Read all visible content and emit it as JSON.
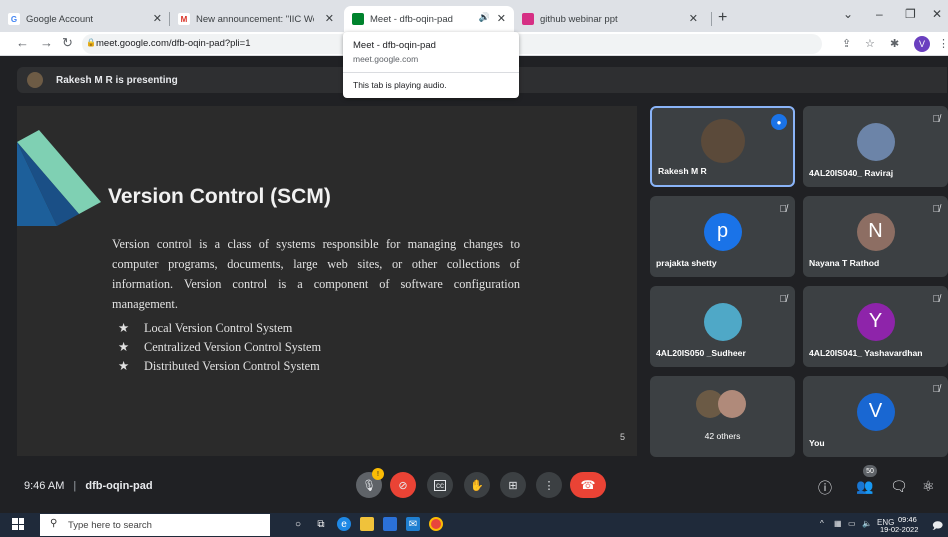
{
  "browser": {
    "tabs": [
      {
        "title": "Google Account",
        "close": "✕"
      },
      {
        "title": "New announcement: \"IIC Webina",
        "close": "✕"
      },
      {
        "title": "Meet - dfb-oqin-pad",
        "close": "✕",
        "audio": "🔊"
      },
      {
        "title": "github webinar ppt",
        "close": "✕"
      }
    ],
    "new_tab": "+",
    "window_controls": {
      "dropdown": "⌄",
      "minimize": "–",
      "restore": "❐",
      "close": "✕"
    },
    "url": "meet.google.com/dfb-oqin-pad?pli=1",
    "profile_initial": "V",
    "hover_card": {
      "title": "Meet - dfb-oqin-pad",
      "domain": "meet.google.com",
      "status": "This tab is playing audio."
    }
  },
  "meet": {
    "presenting_text": "Rakesh M R is presenting",
    "slide": {
      "title": "Version Control (SCM)",
      "body": "Version control is a class of systems responsible for managing changes to computer programs, documents, large web sites, or other collections of information. Version control is a component of software configuration management.",
      "bullets": [
        "Local Version Control System",
        "Centralized Version Control System",
        "Distributed Version Control System"
      ],
      "bullet_marker": "★",
      "page_number": "5"
    },
    "participants": [
      {
        "name": "Rakesh M R",
        "initial": "",
        "color": "#5b4a3a",
        "active": true
      },
      {
        "name": "4AL20IS040_ Raviraj",
        "initial": "",
        "color": "#6c84a8"
      },
      {
        "name": "prajakta shetty",
        "initial": "p",
        "color": "#1a73e8"
      },
      {
        "name": "Nayana T Rathod",
        "initial": "N",
        "color": "#8d6e63"
      },
      {
        "name": "4AL20IS050 _Sudheer",
        "initial": "",
        "color": "#4fa8c7"
      },
      {
        "name": "4AL20IS041_ Yashavardhan",
        "initial": "Y",
        "color": "#8e24aa"
      },
      {
        "name": "42 others",
        "initial": "",
        "color": "#6b5a45"
      },
      {
        "name": "You",
        "initial": "V",
        "color": "#1967d2"
      }
    ],
    "meeting_time": "9:46 AM",
    "meeting_separator": "|",
    "meeting_code": "dfb-oqin-pad",
    "mic_badge": "!",
    "people_count": "50"
  },
  "taskbar": {
    "search_placeholder": "Type here to search",
    "language": "ENG",
    "time": "09:46",
    "date": "19-02-2022"
  },
  "colors": {
    "meet_bg": "#202124",
    "tile_bg": "#3c4043",
    "red": "#ea4335",
    "accent_blue": "#8ab4f8"
  }
}
